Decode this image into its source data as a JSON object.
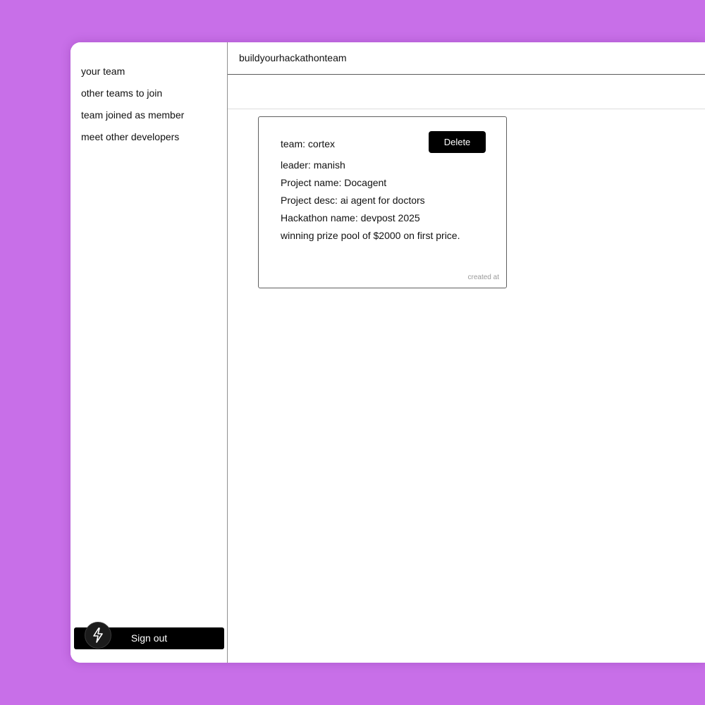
{
  "sidebar": {
    "items": [
      {
        "label": "your team"
      },
      {
        "label": "other teams to join"
      },
      {
        "label": "team joined as member"
      },
      {
        "label": "meet other developers"
      }
    ],
    "signout_label": "Sign out"
  },
  "header": {
    "title": "buildyourhackathonteam"
  },
  "card": {
    "team": "team: cortex",
    "delete_label": "Delete",
    "leader": "leader: manish",
    "project_name": "Project name: Docagent",
    "project_desc": "Project desc: ai agent for doctors",
    "hackathon_name": "Hackathon name: devpost 2025",
    "prize": "winning prize pool of $2000 on first price.",
    "meta": "created at"
  },
  "colors": {
    "background": "#c86fe8",
    "button": "#000000",
    "panel": "#ffffff"
  },
  "icons": {
    "signout_badge": "bolt-icon"
  }
}
